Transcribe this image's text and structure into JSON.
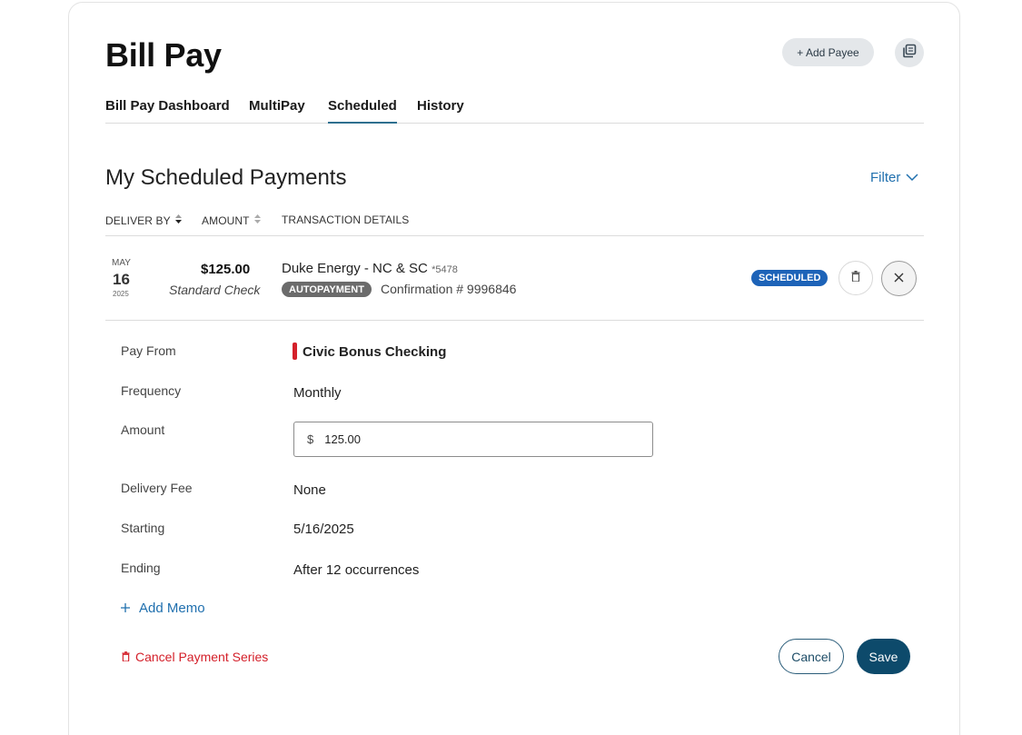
{
  "header": {
    "title": "Bill Pay",
    "add_payee_label": "+ Add Payee",
    "copy_icon": "copy-icon"
  },
  "tabs": [
    {
      "label": "Bill Pay Dashboard",
      "active": false
    },
    {
      "label": "MultiPay",
      "active": false
    },
    {
      "label": "Scheduled",
      "active": true
    },
    {
      "label": "History",
      "active": false
    }
  ],
  "section": {
    "title": "My Scheduled Payments",
    "filter_label": "Filter"
  },
  "columns": {
    "deliver_by": "DELIVER BY",
    "amount": "AMOUNT",
    "details": "TRANSACTION DETAILS"
  },
  "payment": {
    "month": "MAY",
    "day": "16",
    "year": "2025",
    "amount": "$125.00",
    "method": "Standard Check",
    "payee": "Duke Energy - NC & SC",
    "payee_account": "*5478",
    "autopay_badge": "AUTOPAYMENT",
    "confirmation": "Confirmation # 9996846",
    "status": "SCHEDULED"
  },
  "details": {
    "pay_from_label": "Pay From",
    "pay_from_value": "Civic Bonus Checking",
    "frequency_label": "Frequency",
    "frequency_value": "Monthly",
    "amount_label": "Amount",
    "currency_symbol": "$",
    "amount_value": "125.00",
    "delivery_fee_label": "Delivery Fee",
    "delivery_fee_value": "None",
    "starting_label": "Starting",
    "starting_value": "5/16/2025",
    "ending_label": "Ending",
    "ending_value": "After 12 occurrences"
  },
  "actions": {
    "add_memo": "Add Memo",
    "cancel_series": "Cancel Payment Series",
    "cancel": "Cancel",
    "save": "Save"
  },
  "colors": {
    "accent": "#0d4a6b",
    "link": "#1f6fae",
    "danger": "#d4202a",
    "status": "#1d63b8"
  }
}
